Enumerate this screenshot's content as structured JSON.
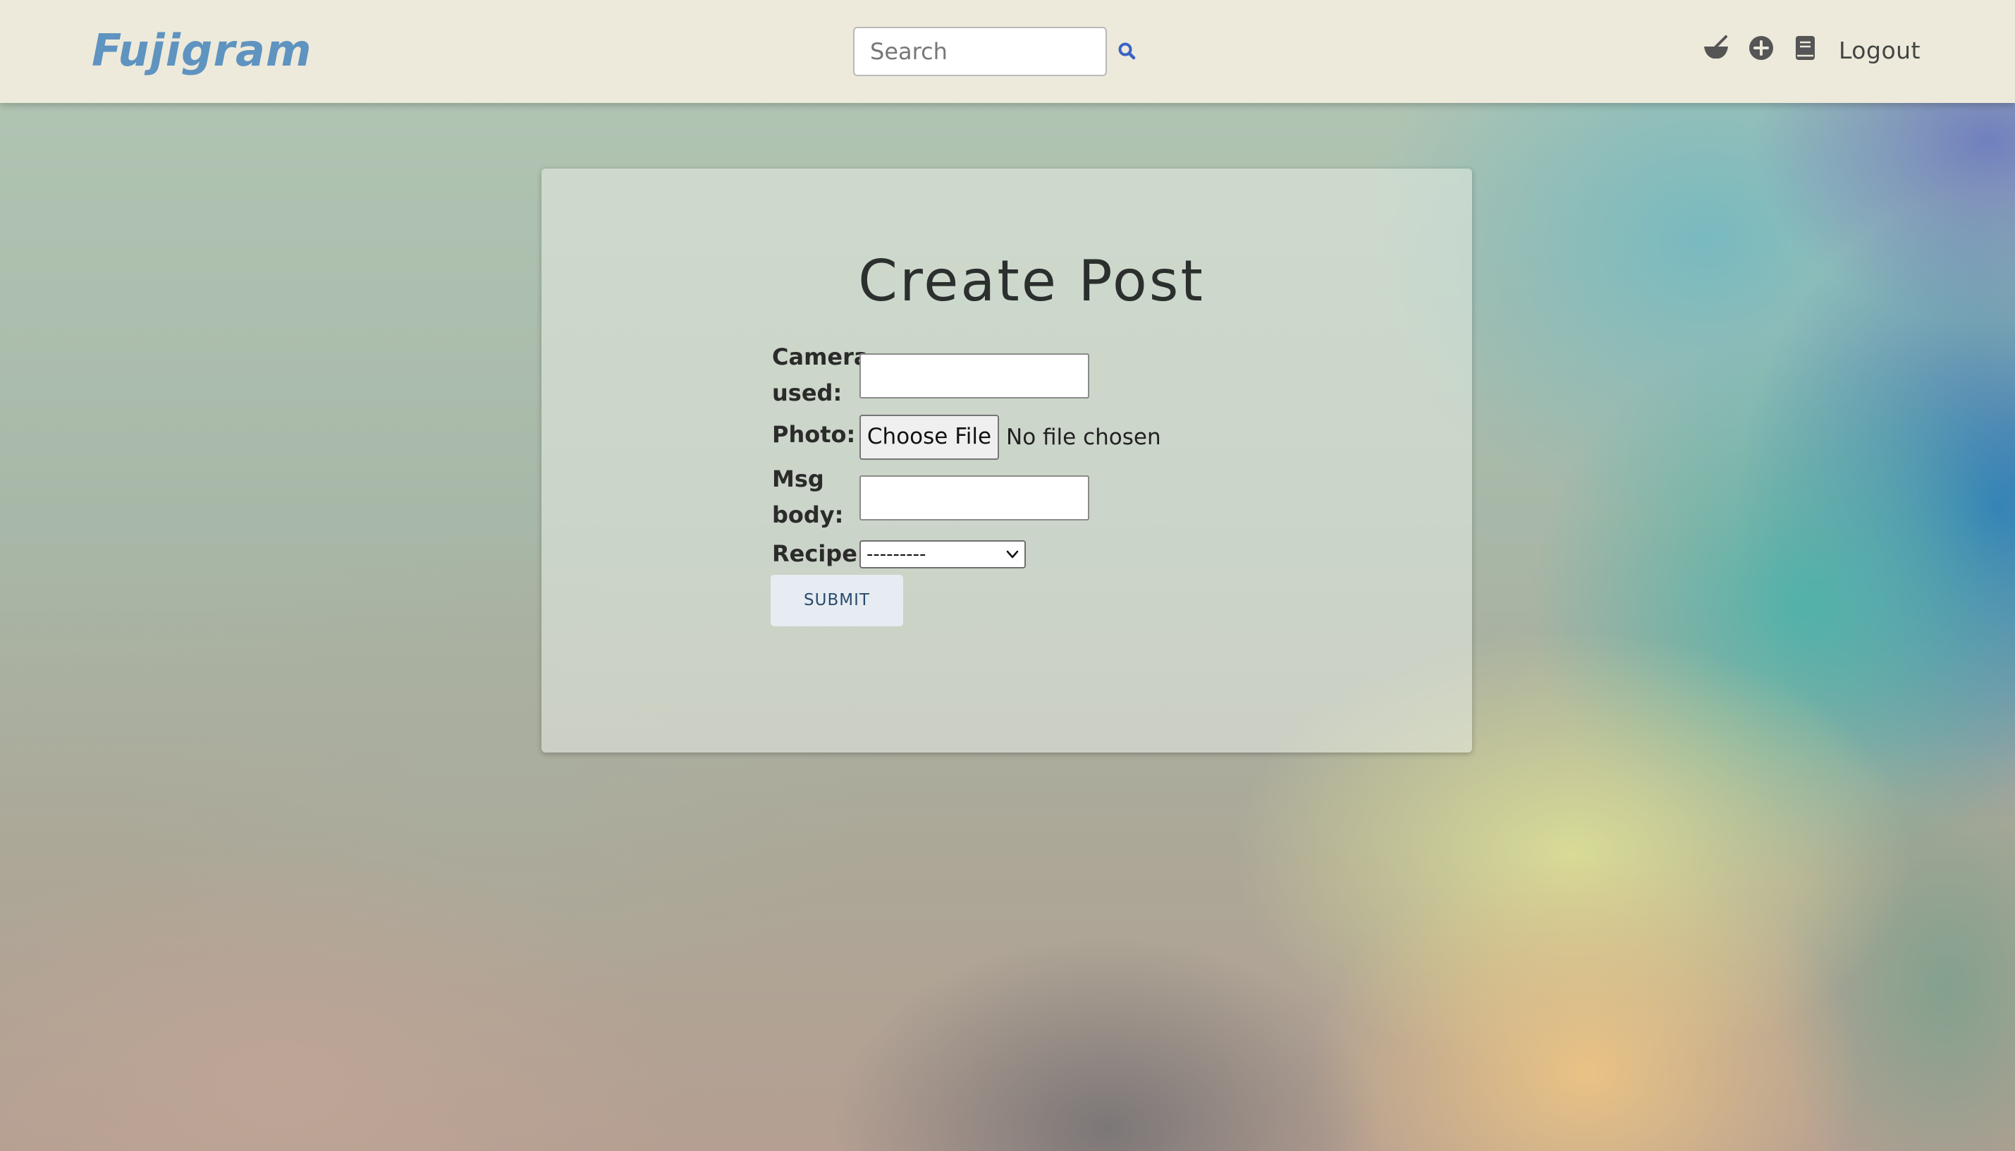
{
  "navbar": {
    "brand": "Fujigram",
    "search_placeholder": "Search",
    "search_value": "",
    "logout_label": "Logout",
    "icons": [
      "search-icon",
      "bowl-icon",
      "plus-circle-icon",
      "book-icon"
    ]
  },
  "form": {
    "title": "Create Post",
    "camera_label": "Camera used:",
    "camera_value": "",
    "photo_label": "Photo:",
    "choose_file_label": "Choose File",
    "file_status": "No file chosen",
    "msg_label": "Msg body:",
    "msg_value": "",
    "recipe_label": "Recipe:",
    "recipe_selected": "---------",
    "submit_label": "SUBMIT"
  },
  "colors": {
    "navbar_bg": "#edeadb",
    "brand": "#5f93c0",
    "search_icon": "#3b63c4",
    "nav_icons": "#555555",
    "submit_bg": "#e6ecf2",
    "submit_text": "#2c4b6e"
  }
}
